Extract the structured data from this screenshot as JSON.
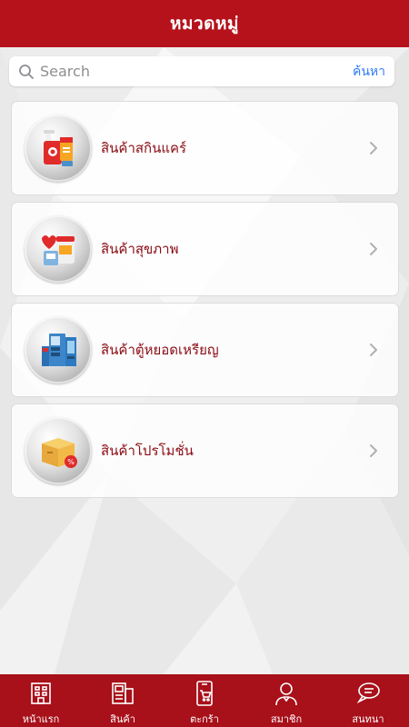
{
  "header": {
    "title": "หมวดหมู่"
  },
  "search": {
    "placeholder": "Search",
    "value": "",
    "button_label": "ค้นหา"
  },
  "categories": [
    {
      "label": "สินค้าสกินแคร์",
      "icon": "skincare-icon"
    },
    {
      "label": "สินค้าสุขภาพ",
      "icon": "health-icon"
    },
    {
      "label": "สินค้าตู้หยอดเหรียญ",
      "icon": "vending-machine-icon"
    },
    {
      "label": "สินค้าโปรโมชั่น",
      "icon": "promotion-box-icon"
    }
  ],
  "tabbar": {
    "items": [
      {
        "label": "หน้าแรก",
        "icon": "home-building-icon"
      },
      {
        "label": "สินค้า",
        "icon": "products-icon"
      },
      {
        "label": "ตะกร้า",
        "icon": "cart-phone-icon"
      },
      {
        "label": "สมาชิก",
        "icon": "member-icon"
      },
      {
        "label": "สนทนา",
        "icon": "chat-icon"
      }
    ]
  },
  "colors": {
    "brand_red": "#b5121b",
    "tabbar_red": "#a8101a",
    "label_red": "#8b0c14",
    "search_link_blue": "#2f7cf6"
  }
}
